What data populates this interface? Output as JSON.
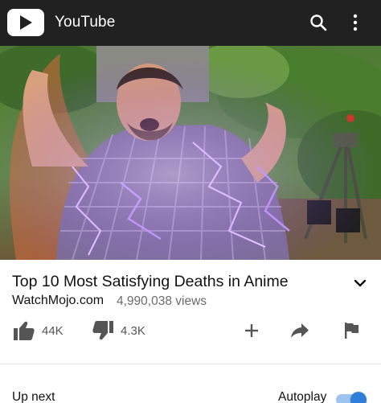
{
  "app": {
    "title": "YouTube",
    "logo_icon": "youtube-play-logo-icon",
    "bar_color": "#212121"
  },
  "video": {
    "title": "Top 10 Most Satisfying Deaths in Anime",
    "channel": "WatchMojo.com",
    "views": "4,990,038 views",
    "thumbnail_icon": "video-frame"
  },
  "actions": {
    "likes": "44K",
    "dislikes": "4.3K",
    "icons": [
      "thumb-up-icon",
      "thumb-down-icon",
      "add-icon",
      "share-icon",
      "flag-icon"
    ]
  },
  "up_next": {
    "label": "Up next",
    "autoplay_label": "Autoplay",
    "autoplay_on": true,
    "toggle_color": "#2f7fd8"
  }
}
